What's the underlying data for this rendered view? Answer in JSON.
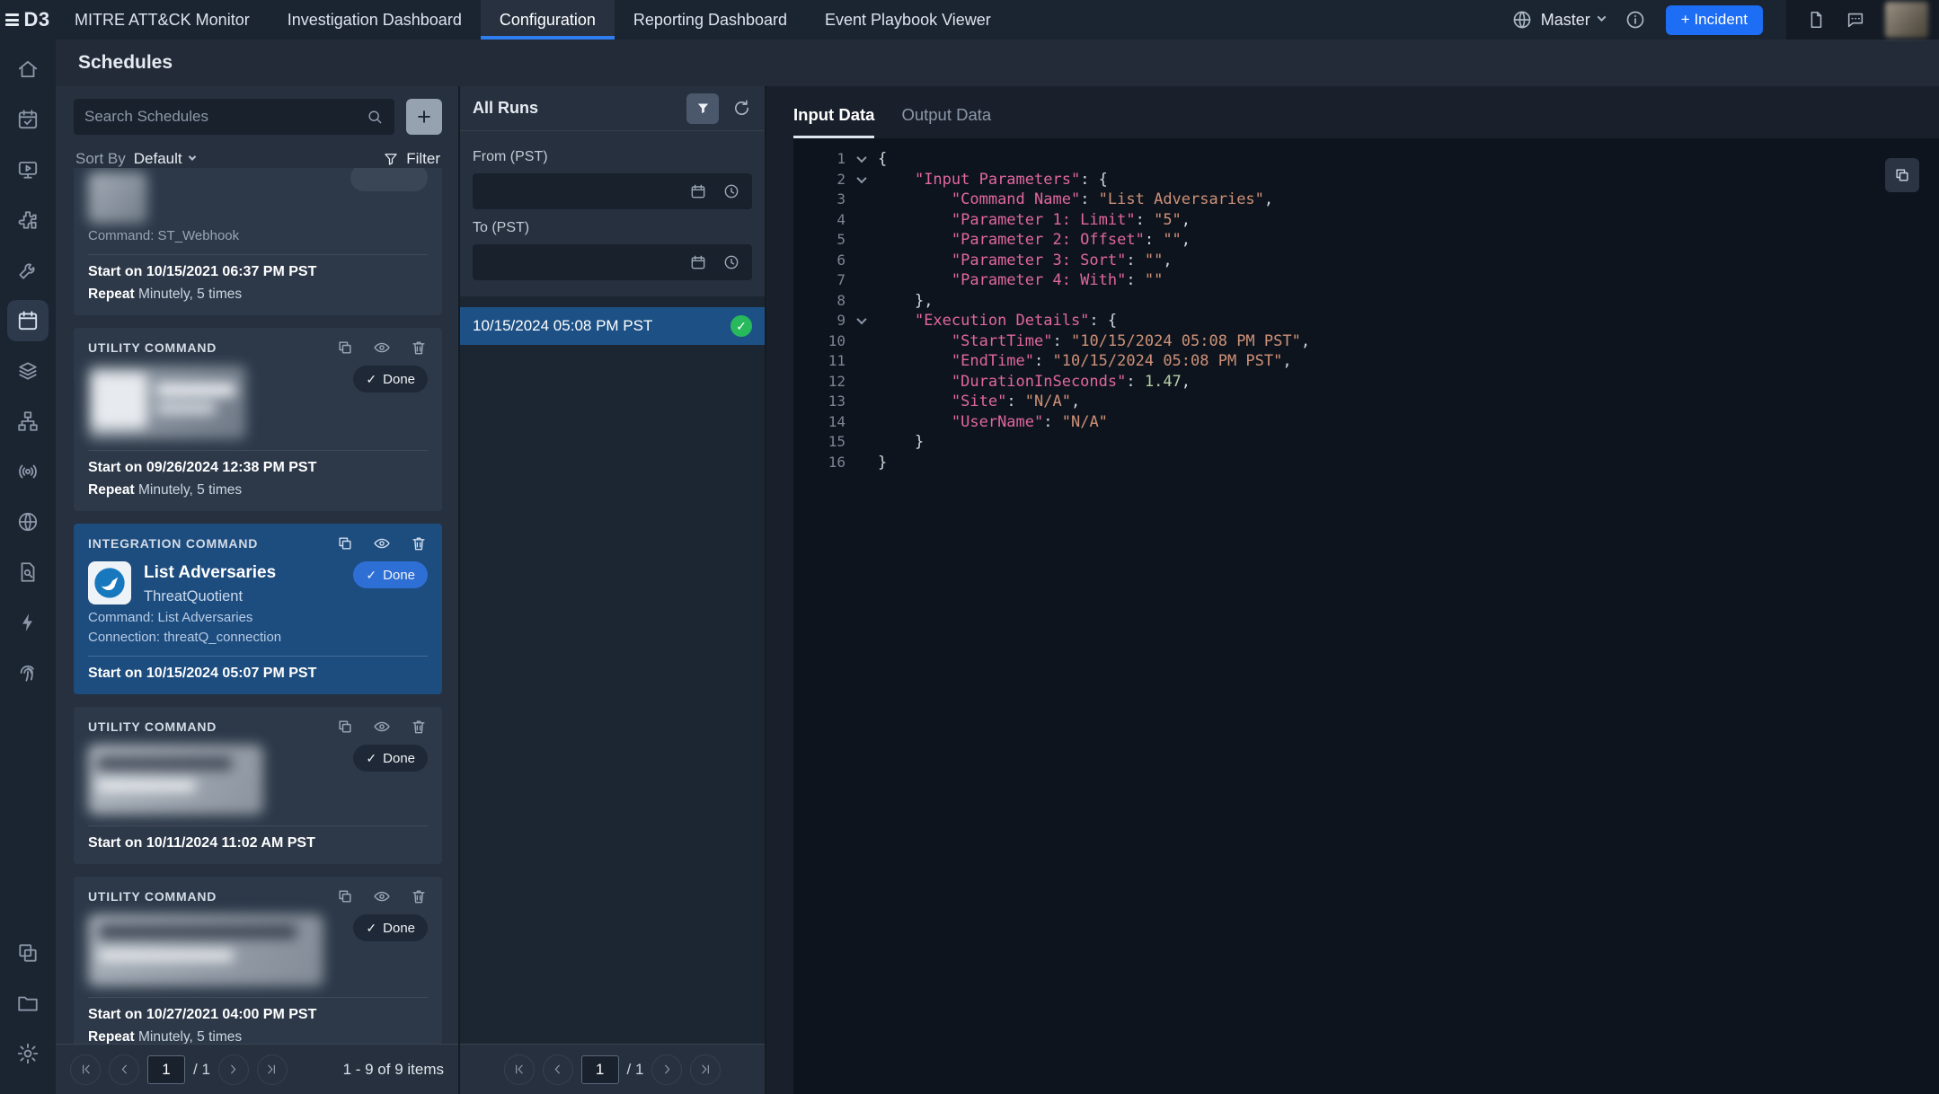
{
  "icons": {
    "check": "✓",
    "plus": "+"
  },
  "topbar": {
    "brand": "D3",
    "nav": [
      {
        "label": "MITRE ATT&CK Monitor"
      },
      {
        "label": "Investigation Dashboard"
      },
      {
        "label": "Configuration"
      },
      {
        "label": "Reporting Dashboard"
      },
      {
        "label": "Event Playbook Viewer"
      }
    ],
    "master_label": "Master",
    "incident_button": "+ Incident"
  },
  "page": {
    "title": "Schedules"
  },
  "schedules_panel": {
    "search_placeholder": "Search Schedules",
    "sort_by_label": "Sort By",
    "sort_value": "Default",
    "filter_label": "Filter",
    "cards": [
      {
        "command": "Command: ST_Webhook",
        "start": "Start on 10/15/2021 06:37 PM PST",
        "repeat_bold": "Repeat",
        "repeat_rest": " Minutely, 5 times"
      },
      {
        "header": "UTILITY COMMAND",
        "done_label": "Done",
        "start": "Start on 09/26/2024 12:38 PM PST",
        "repeat_bold": "Repeat",
        "repeat_rest": " Minutely, 5 times"
      },
      {
        "header": "INTEGRATION COMMAND",
        "title": "List Adversaries",
        "subtitle": "ThreatQuotient",
        "done_label": "Done",
        "command": "Command: List Adversaries",
        "connection": "Connection: threatQ_connection",
        "start": "Start on 10/15/2024 05:07 PM PST"
      },
      {
        "header": "UTILITY COMMAND",
        "done_label": "Done",
        "start": "Start on 10/11/2024 11:02 AM PST"
      },
      {
        "header": "UTILITY COMMAND",
        "done_label": "Done",
        "start": "Start on 10/27/2021 04:00 PM PST",
        "repeat_bold": "Repeat",
        "repeat_rest": " Minutely, 5 times"
      }
    ],
    "pagination": {
      "page": "1",
      "of": "/ 1",
      "summary": "1 - 9 of 9 items"
    }
  },
  "runs_panel": {
    "title": "All Runs",
    "from_label": "From (PST)",
    "to_label": "To (PST)",
    "runs": [
      {
        "label": "10/15/2024 05:08 PM PST",
        "status": "success"
      }
    ],
    "pagination": {
      "page": "1",
      "of": "/ 1"
    }
  },
  "detail_panel": {
    "tabs": [
      {
        "label": "Input Data"
      },
      {
        "label": "Output Data"
      }
    ],
    "code_lines": [
      {
        "n": 1,
        "fold": true,
        "seg": [
          [
            "p",
            "{"
          ]
        ]
      },
      {
        "n": 2,
        "fold": true,
        "seg": [
          [
            "w",
            "    "
          ],
          [
            "k",
            "\"Input Parameters\""
          ],
          [
            "p",
            ": {"
          ]
        ]
      },
      {
        "n": 3,
        "seg": [
          [
            "w",
            "        "
          ],
          [
            "k",
            "\"Command Name\""
          ],
          [
            "p",
            ": "
          ],
          [
            "s",
            "\"List Adversaries\""
          ],
          [
            "p",
            ","
          ]
        ]
      },
      {
        "n": 4,
        "seg": [
          [
            "w",
            "        "
          ],
          [
            "k",
            "\"Parameter 1: Limit\""
          ],
          [
            "p",
            ": "
          ],
          [
            "s",
            "\"5\""
          ],
          [
            "p",
            ","
          ]
        ]
      },
      {
        "n": 5,
        "seg": [
          [
            "w",
            "        "
          ],
          [
            "k",
            "\"Parameter 2: Offset\""
          ],
          [
            "p",
            ": "
          ],
          [
            "s",
            "\"\""
          ],
          [
            "p",
            ","
          ]
        ]
      },
      {
        "n": 6,
        "seg": [
          [
            "w",
            "        "
          ],
          [
            "k",
            "\"Parameter 3: Sort\""
          ],
          [
            "p",
            ": "
          ],
          [
            "s",
            "\"\""
          ],
          [
            "p",
            ","
          ]
        ]
      },
      {
        "n": 7,
        "seg": [
          [
            "w",
            "        "
          ],
          [
            "k",
            "\"Parameter 4: With\""
          ],
          [
            "p",
            ": "
          ],
          [
            "s",
            "\"\""
          ]
        ]
      },
      {
        "n": 8,
        "seg": [
          [
            "w",
            "    "
          ],
          [
            "p",
            "},"
          ]
        ]
      },
      {
        "n": 9,
        "fold": true,
        "seg": [
          [
            "w",
            "    "
          ],
          [
            "k",
            "\"Execution Details\""
          ],
          [
            "p",
            ": {"
          ]
        ]
      },
      {
        "n": 10,
        "seg": [
          [
            "w",
            "        "
          ],
          [
            "k",
            "\"StartTime\""
          ],
          [
            "p",
            ": "
          ],
          [
            "s",
            "\"10/15/2024 05:08 PM PST\""
          ],
          [
            "p",
            ","
          ]
        ]
      },
      {
        "n": 11,
        "seg": [
          [
            "w",
            "        "
          ],
          [
            "k",
            "\"EndTime\""
          ],
          [
            "p",
            ": "
          ],
          [
            "s",
            "\"10/15/2024 05:08 PM PST\""
          ],
          [
            "p",
            ","
          ]
        ]
      },
      {
        "n": 12,
        "seg": [
          [
            "w",
            "        "
          ],
          [
            "k",
            "\"DurationInSeconds\""
          ],
          [
            "p",
            ": "
          ],
          [
            "num",
            "1.47"
          ],
          [
            "p",
            ","
          ]
        ]
      },
      {
        "n": 13,
        "seg": [
          [
            "w",
            "        "
          ],
          [
            "k",
            "\"Site\""
          ],
          [
            "p",
            ": "
          ],
          [
            "s",
            "\"N/A\""
          ],
          [
            "p",
            ","
          ]
        ]
      },
      {
        "n": 14,
        "seg": [
          [
            "w",
            "        "
          ],
          [
            "k",
            "\"UserName\""
          ],
          [
            "p",
            ": "
          ],
          [
            "s",
            "\"N/A\""
          ]
        ]
      },
      {
        "n": 15,
        "seg": [
          [
            "w",
            "    "
          ],
          [
            "p",
            "}"
          ]
        ]
      },
      {
        "n": 16,
        "seg": [
          [
            "p",
            "}"
          ]
        ]
      }
    ]
  }
}
